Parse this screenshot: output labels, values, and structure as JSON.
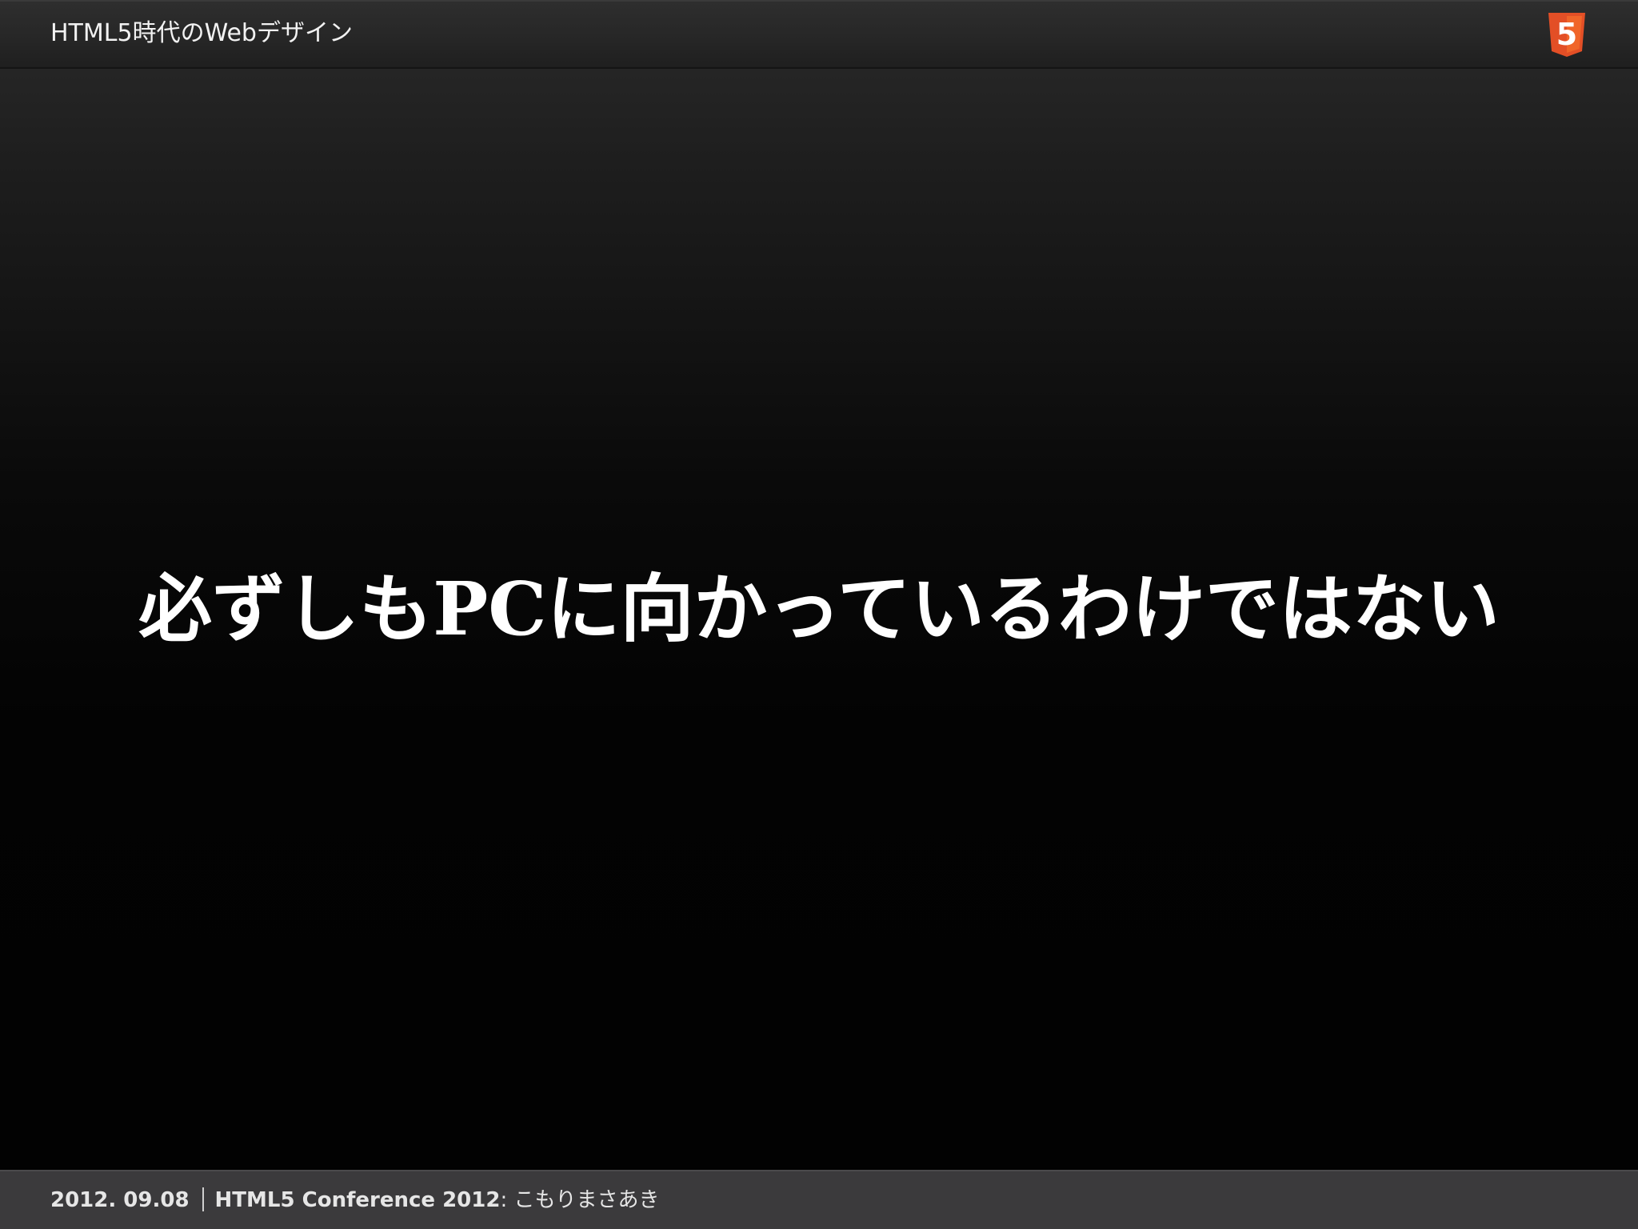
{
  "header": {
    "title": "HTML5時代のWebデザイン",
    "logo_text": "5",
    "logo_color": "#e34f26"
  },
  "main": {
    "headline": "必ずしもPCに向かっているわけではない"
  },
  "footer": {
    "date": "2012. 09.08",
    "event": "HTML5 Conference 2012",
    "separator": ":",
    "author": "こもりまさあき"
  }
}
